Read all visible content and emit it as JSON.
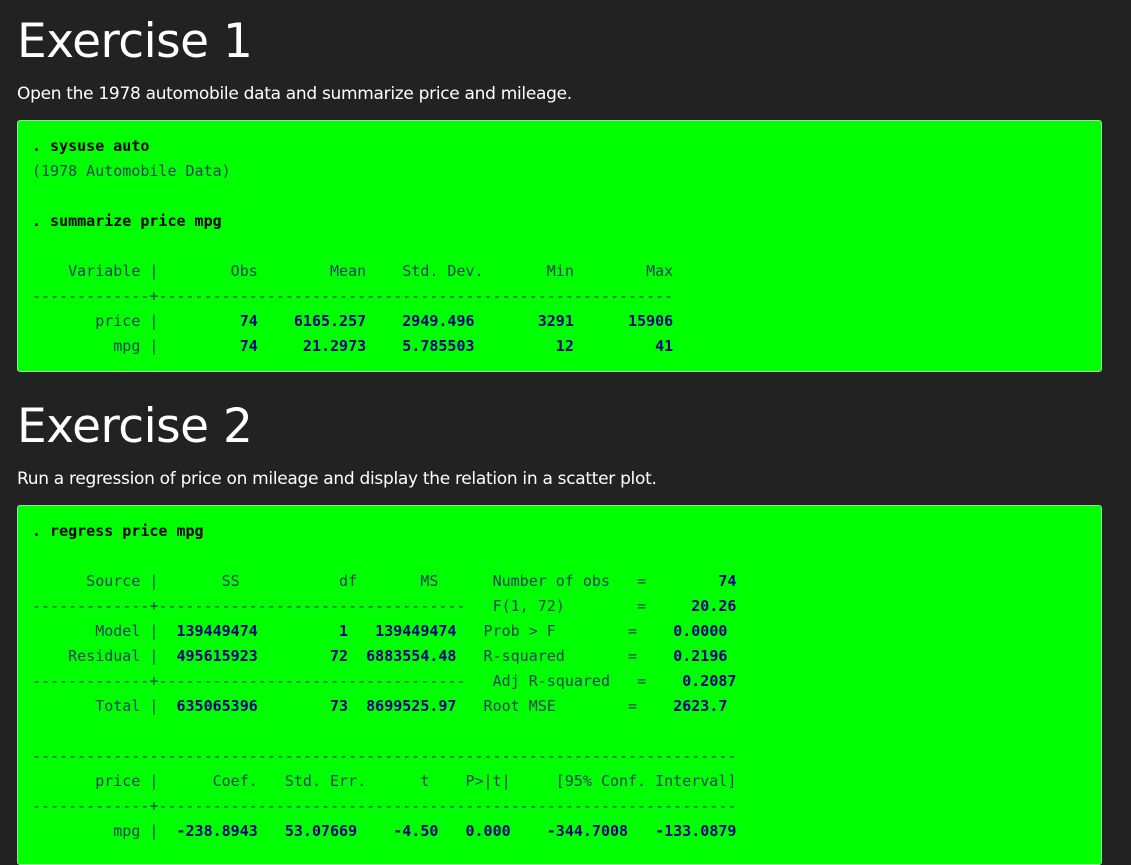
{
  "exercise1": {
    "title": "Exercise 1",
    "description": "Open the 1978 automobile data and summarize price and mileage.",
    "cmd_sysuse": ". sysuse auto",
    "dataset_note": "(1978 Automobile Data)",
    "cmd_summarize": ". summarize price mpg",
    "header_row": "    Variable |        Obs        Mean    Std. Dev.       Min        Max",
    "separator": "-------------+---------------------------------------------------------",
    "rows": [
      {
        "label": "       price |",
        "values": "         74    6165.257    2949.496       3291      15906"
      },
      {
        "label": "         mpg |",
        "values": "         74     21.2973    5.785503         12         41"
      }
    ]
  },
  "exercise2": {
    "title": "Exercise 2",
    "description": "Run a regression of price on mileage and display the relation in a scatter plot.",
    "cmd_regress": ". regress price mpg",
    "anova_lines": [
      {
        "left": "      Source |       SS           df       MS   ",
        "leftcls": "res",
        "nums": "",
        "stat": "   Number of obs   =",
        "statval": "        74"
      },
      {
        "left": "-------------+----------------------------------",
        "leftcls": "sep",
        "nums": "",
        "stat": "   F(1, 72)        =",
        "statval": "     20.26"
      },
      {
        "left": "       Model |",
        "leftcls": "res",
        "nums": "  139449474         1   139449474",
        "stat": "   Prob > F        =",
        "statval": "    0.0000"
      },
      {
        "left": "    Residual |",
        "leftcls": "res",
        "nums": "  495615923        72  6883554.48",
        "stat": "   R-squared       =",
        "statval": "    0.2196"
      },
      {
        "left": "-------------+----------------------------------",
        "leftcls": "sep",
        "nums": "",
        "stat": "   Adj R-squared   =",
        "statval": "    0.2087"
      },
      {
        "left": "       Total |",
        "leftcls": "res",
        "nums": "  635065396        73  8699525.97",
        "stat": "   Root MSE        =",
        "statval": "    2623.7"
      }
    ],
    "coef_separator_top": "------------------------------------------------------------------------------",
    "coef_header": "       price |      Coef.   Std. Err.      t    P>|t|     [95% Conf. Interval]",
    "coef_separator_mid": "-------------+----------------------------------------------------------------",
    "coef_row_label": "         mpg |",
    "coef_row_values": "  -238.8943   53.07669    -4.50   0.000    -344.7008   -133.0879"
  },
  "colors": {
    "page_background": "#222222",
    "output_background": "#00ff00",
    "command_text": "#000000",
    "result_text": "#1f3f5f",
    "number_text": "#000080"
  }
}
